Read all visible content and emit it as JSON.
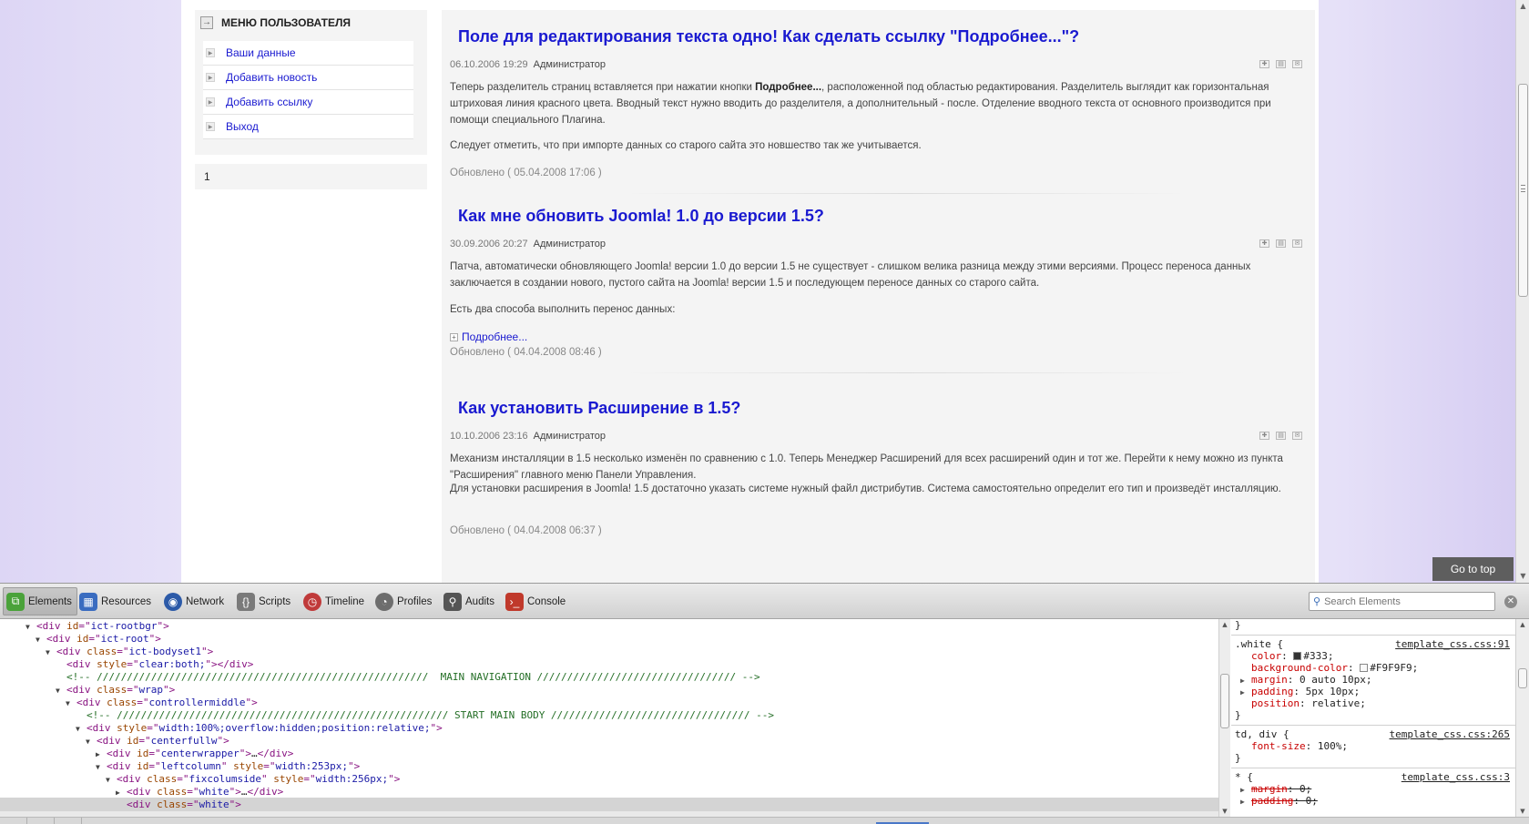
{
  "user_menu": {
    "title": "МЕНЮ ПОЛЬЗОВАТЕЛЯ",
    "items": [
      {
        "label": "Ваши данные"
      },
      {
        "label": "Добавить новость"
      },
      {
        "label": "Добавить ссылку"
      },
      {
        "label": "Выход"
      }
    ]
  },
  "pager": {
    "current": "1"
  },
  "articles": [
    {
      "title": "Поле для редактирования текста одно! Как сделать ссылку \"Подробнее...\"?",
      "date": "06.10.2006 19:29",
      "author": "Администратор",
      "paragraphs": [
        {
          "before": "Теперь разделитель страниц вставляется при нажатии кнопки ",
          "bold": "Подробнее...",
          "after": ", расположенной под областью редактирования. Разделитель выглядит как горизонтальная штриховая линия красного цвета. Вводный текст нужно вводить до разделителя, а дополнительный - после. Отделение вводного текста от основного производится при помощи специального Плагина."
        },
        {
          "before": "Следует отметить, что при импорте данных со старого сайта это новшество так же учитывается.",
          "bold": "",
          "after": ""
        }
      ],
      "readmore": "",
      "updated": "Обновлено ( 05.04.2008 17:06 )"
    },
    {
      "title": "Как мне обновить Joomla! 1.0 до версии 1.5?",
      "date": "30.09.2006 20:27",
      "author": "Администратор",
      "paragraphs": [
        {
          "before": "Патча, автоматически обновляющего Joomla! версии 1.0 до версии 1.5 не существует - слишком велика разница между этими версиями. Процесс переноса данных заключается в создании нового, пустого сайта на Joomla! версии 1.5 и последующем переносе данных со старого сайта.",
          "bold": "",
          "after": ""
        },
        {
          "before": "Есть два способа выполнить перенос данных:",
          "bold": "",
          "after": ""
        }
      ],
      "readmore": "Подробнее...",
      "updated": "Обновлено ( 04.04.2008 08:46 )"
    },
    {
      "title": "Как установить Расширение в 1.5?",
      "date": "10.10.2006 23:16",
      "author": "Администратор",
      "paragraphs": [
        {
          "before": "Механизм инсталляции в 1.5 несколько изменён по сравнению с 1.0. Теперь Менеджер Расширений для всех расширений один и тот же. Перейти к нему можно из пункта \"Расширения\" главного меню Панели Управления.",
          "bold": "",
          "after": ""
        },
        {
          "before": "Для установки расширения в Joomla! 1.5 достаточно указать системе нужный файл дистрибутив. Система самостоятельно определит его тип и произведёт инсталляцию.",
          "bold": "",
          "after": ""
        }
      ],
      "readmore": "",
      "updated": "Обновлено ( 04.04.2008 06:37 )"
    }
  ],
  "go_top": "Go to top",
  "devtools": {
    "tabs": [
      {
        "label": "Elements",
        "icon": "elements-icon",
        "color": "#4aa23a"
      },
      {
        "label": "Resources",
        "icon": "resources-icon",
        "color": "#3a6cc0"
      },
      {
        "label": "Network",
        "icon": "network-icon",
        "color": "#2c5aa8"
      },
      {
        "label": "Scripts",
        "icon": "scripts-icon",
        "color": "#7a7a7a"
      },
      {
        "label": "Timeline",
        "icon": "timeline-icon",
        "color": "#c03a3a"
      },
      {
        "label": "Profiles",
        "icon": "profiles-icon",
        "color": "#6d6d6d"
      },
      {
        "label": "Audits",
        "icon": "audits-icon",
        "color": "#555555"
      },
      {
        "label": "Console",
        "icon": "console-icon",
        "color": "#c0392b"
      }
    ],
    "active_tab": "Elements",
    "search_placeholder": "Search Elements",
    "dom_lines": [
      {
        "indent": 2,
        "tri": "▼",
        "parts": [
          [
            "tag",
            "<div "
          ],
          [
            "attr",
            "id"
          ],
          [
            "tag",
            "=\""
          ],
          [
            "val",
            "ict-rootbgr"
          ],
          [
            "tag",
            "\">"
          ]
        ]
      },
      {
        "indent": 3,
        "tri": "▼",
        "parts": [
          [
            "tag",
            "<div "
          ],
          [
            "attr",
            "id"
          ],
          [
            "tag",
            "=\""
          ],
          [
            "val",
            "ict-root"
          ],
          [
            "tag",
            "\">"
          ]
        ]
      },
      {
        "indent": 4,
        "tri": "▼",
        "parts": [
          [
            "tag",
            "<div "
          ],
          [
            "attr",
            "class"
          ],
          [
            "tag",
            "=\""
          ],
          [
            "val",
            "ict-bodyset1"
          ],
          [
            "tag",
            "\">"
          ]
        ]
      },
      {
        "indent": 5,
        "tri": "",
        "parts": [
          [
            "tag",
            "<div "
          ],
          [
            "attr",
            "style"
          ],
          [
            "tag",
            "=\""
          ],
          [
            "val",
            "clear:both;"
          ],
          [
            "tag",
            "\"></div>"
          ]
        ]
      },
      {
        "indent": 5,
        "tri": "",
        "parts": [
          [
            "cmt",
            "<!-- ///////////////////////////////////////////////////////  MAIN NAVIGATION ///////////////////////////////// -->"
          ]
        ]
      },
      {
        "indent": 5,
        "tri": "▼",
        "parts": [
          [
            "tag",
            "<div "
          ],
          [
            "attr",
            "class"
          ],
          [
            "tag",
            "=\""
          ],
          [
            "val",
            "wrap"
          ],
          [
            "tag",
            "\">"
          ]
        ]
      },
      {
        "indent": 6,
        "tri": "▼",
        "parts": [
          [
            "tag",
            "<div "
          ],
          [
            "attr",
            "class"
          ],
          [
            "tag",
            "=\""
          ],
          [
            "val",
            "controllermiddle"
          ],
          [
            "tag",
            "\">"
          ]
        ]
      },
      {
        "indent": 7,
        "tri": "",
        "parts": [
          [
            "cmt",
            "<!-- /////////////////////////////////////////////////////// START MAIN BODY ///////////////////////////////// -->"
          ]
        ]
      },
      {
        "indent": 7,
        "tri": "▼",
        "parts": [
          [
            "tag",
            "<div "
          ],
          [
            "attr",
            "style"
          ],
          [
            "tag",
            "=\""
          ],
          [
            "val",
            "width:100%;overflow:hidden;position:relative;"
          ],
          [
            "tag",
            "\">"
          ]
        ]
      },
      {
        "indent": 8,
        "tri": "▼",
        "parts": [
          [
            "tag",
            "<div "
          ],
          [
            "attr",
            "id"
          ],
          [
            "tag",
            "=\""
          ],
          [
            "val",
            "centerfullw"
          ],
          [
            "tag",
            "\">"
          ]
        ]
      },
      {
        "indent": 9,
        "tri": "▶",
        "parts": [
          [
            "tag",
            "<div "
          ],
          [
            "attr",
            "id"
          ],
          [
            "tag",
            "=\""
          ],
          [
            "val",
            "centerwrapper"
          ],
          [
            "tag",
            "\">"
          ],
          [
            "plain",
            "…"
          ],
          [
            "tag",
            "</div>"
          ]
        ]
      },
      {
        "indent": 9,
        "tri": "▼",
        "parts": [
          [
            "tag",
            "<div "
          ],
          [
            "attr",
            "id"
          ],
          [
            "tag",
            "=\""
          ],
          [
            "val",
            "leftcolumn"
          ],
          [
            "tag",
            "\" "
          ],
          [
            "attr",
            "style"
          ],
          [
            "tag",
            "=\""
          ],
          [
            "val",
            "width:253px;"
          ],
          [
            "tag",
            "\">"
          ]
        ]
      },
      {
        "indent": 10,
        "tri": "▼",
        "parts": [
          [
            "tag",
            "<div "
          ],
          [
            "attr",
            "class"
          ],
          [
            "tag",
            "=\""
          ],
          [
            "val",
            "fixcolumside"
          ],
          [
            "tag",
            "\" "
          ],
          [
            "attr",
            "style"
          ],
          [
            "tag",
            "=\""
          ],
          [
            "val",
            "width:256px;"
          ],
          [
            "tag",
            "\">"
          ]
        ]
      },
      {
        "indent": 11,
        "tri": "▶",
        "parts": [
          [
            "tag",
            "<div "
          ],
          [
            "attr",
            "class"
          ],
          [
            "tag",
            "=\""
          ],
          [
            "val",
            "white"
          ],
          [
            "tag",
            "\">"
          ],
          [
            "plain",
            "…"
          ],
          [
            "tag",
            "</div>"
          ]
        ]
      },
      {
        "indent": 11,
        "tri": "",
        "parts": [
          [
            "tag",
            "<div "
          ],
          [
            "attr",
            "class"
          ],
          [
            "tag",
            "=\""
          ],
          [
            "val",
            "white"
          ],
          [
            "tag",
            "\">"
          ]
        ]
      }
    ],
    "selected_line": 14,
    "styles": [
      {
        "type": "text",
        "text": "}"
      },
      {
        "type": "sep"
      },
      {
        "type": "rule",
        "selector": ".white {",
        "file": "template_css.css:91"
      },
      {
        "type": "prop",
        "tri": "",
        "name": "color",
        "value": "#333;",
        "swatch": "#333333",
        "strike": false
      },
      {
        "type": "prop",
        "tri": "",
        "name": "background-color",
        "value": "#F9F9F9;",
        "swatch": "#F9F9F9",
        "strike": false
      },
      {
        "type": "prop",
        "tri": "▶",
        "name": "margin",
        "value": "0 auto 10px;",
        "swatch": "",
        "strike": false
      },
      {
        "type": "prop",
        "tri": "▶",
        "name": "padding",
        "value": "5px 10px;",
        "swatch": "",
        "strike": false
      },
      {
        "type": "prop",
        "tri": "",
        "name": "position",
        "value": "relative;",
        "swatch": "",
        "strike": false
      },
      {
        "type": "text",
        "text": "}"
      },
      {
        "type": "sep"
      },
      {
        "type": "rule",
        "selector": "td, div {",
        "file": "template_css.css:265"
      },
      {
        "type": "prop",
        "tri": "",
        "name": "font-size",
        "value": "100%;",
        "swatch": "",
        "strike": false
      },
      {
        "type": "text",
        "text": "}"
      },
      {
        "type": "sep"
      },
      {
        "type": "rule",
        "selector": "* {",
        "file": "template_css.css:3"
      },
      {
        "type": "prop",
        "tri": "▶",
        "name": "margin",
        "value": "0;",
        "swatch": "",
        "strike": true
      },
      {
        "type": "prop",
        "tri": "▶",
        "name": "padding",
        "value": "0;",
        "swatch": "",
        "strike": true
      }
    ]
  }
}
